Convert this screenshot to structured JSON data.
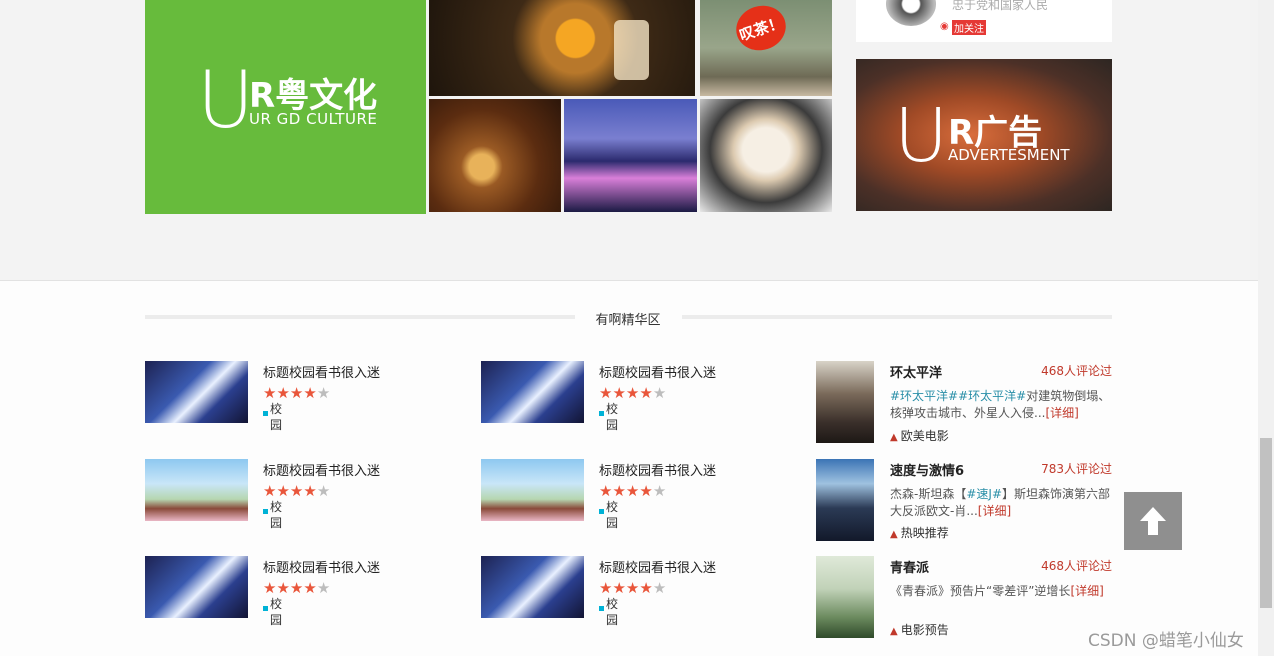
{
  "culture": {
    "u": "U",
    "cn": "R粤文化",
    "en": "UR GD CULTURE"
  },
  "tea_badge": "叹茶！",
  "profile": {
    "motto": "忠于党和国家人民",
    "follow": "加关注",
    "weibo_icon": "◉"
  },
  "ad": {
    "u": "U",
    "cn": "R广告",
    "en": "ADVERTESMENT"
  },
  "section": {
    "title": "有啊精华区"
  },
  "items": [
    {
      "title": "标题校园看书很入迷",
      "rating": 4,
      "tag1": "校",
      "tag2": "园"
    },
    {
      "title": "标题校园看书很入迷",
      "rating": 4,
      "tag1": "校",
      "tag2": "园"
    },
    {
      "title": "标题校园看书很入迷",
      "rating": 4,
      "tag1": "校",
      "tag2": "园"
    },
    {
      "title": "标题校园看书很入迷",
      "rating": 4,
      "tag1": "校",
      "tag2": "园"
    },
    {
      "title": "标题校园看书很入迷",
      "rating": 4,
      "tag1": "校",
      "tag2": "园"
    },
    {
      "title": "标题校园看书很入迷",
      "rating": 4,
      "tag1": "校",
      "tag2": "园"
    }
  ],
  "stars": {
    "on": "★",
    "off": "★"
  },
  "movies": [
    {
      "title": "环太平洋",
      "count": "468人评论过",
      "hash": "#环太平洋##环太平洋#",
      "desc": "对建筑物倒塌、核弹攻击城市、外星人入侵...",
      "detail": "[详细]",
      "category": "欧美电影"
    },
    {
      "title": "速度与激情6",
      "count": "783人评论过",
      "desc_pre": "杰森-斯坦森【",
      "hash": "#速J#",
      "desc": "】斯坦森饰演第六部大反派欧文-肖...",
      "detail": "[详细]",
      "category": "热映推荐"
    },
    {
      "title": "青春派",
      "count": "468人评论过",
      "desc": "《青春派》预告片“零差评”逆增长",
      "detail": "[详细]",
      "category": "电影预告"
    }
  ],
  "icons": {
    "user": "user-icon",
    "back_top": "arrow-up-icon"
  },
  "watermark": "CSDN @蜡笔小仙女"
}
